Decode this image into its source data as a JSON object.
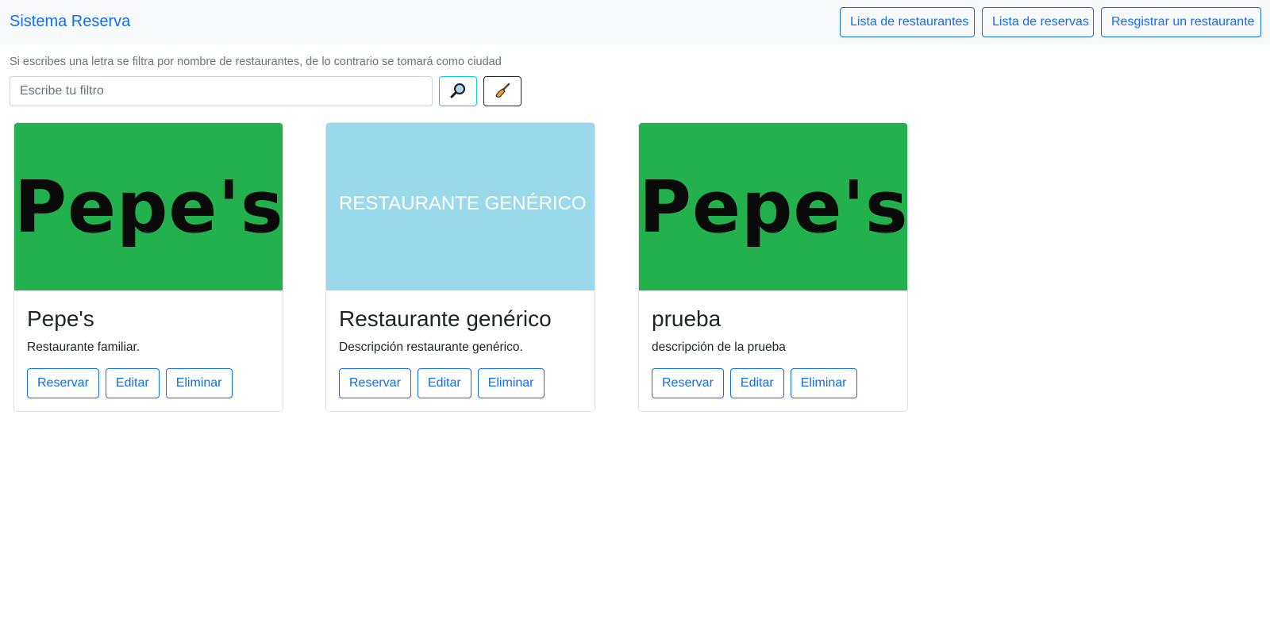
{
  "navbar": {
    "brand": "Sistema Reserva",
    "buttons": [
      "Lista de restaurantes",
      "Lista de reservas",
      "Resgistrar un restaurante"
    ]
  },
  "filter": {
    "hint": "Si escribes una letra se filtra por nombre de restaurantes, de lo contrario se tomará como ciudad",
    "placeholder": "Escribe tu filtro",
    "value": "",
    "search_icon": "magnifier-icon",
    "clear_icon": "broom-icon"
  },
  "restaurants": [
    {
      "image_text": "Pepe's",
      "image_color": "#22b14c",
      "title": "Pepe's",
      "description": "Restaurante familiar.",
      "actions": [
        "Reservar",
        "Editar",
        "Eliminar"
      ]
    },
    {
      "image_text": "RESTAURANTE GENÉRICO",
      "image_color": "#9ad9ea",
      "title": "Restaurante genérico",
      "description": "Descripción restaurante genérico.",
      "actions": [
        "Reservar",
        "Editar",
        "Eliminar"
      ]
    },
    {
      "image_text": "Pepe's",
      "image_color": "#22b14c",
      "title": "prueba",
      "description": "descripción de la prueba",
      "actions": [
        "Reservar",
        "Editar",
        "Eliminar"
      ]
    }
  ],
  "colors": {
    "primary": "#0d6efd",
    "info": "#0dcaf0",
    "navbar_bg": "#f8f9fa"
  }
}
